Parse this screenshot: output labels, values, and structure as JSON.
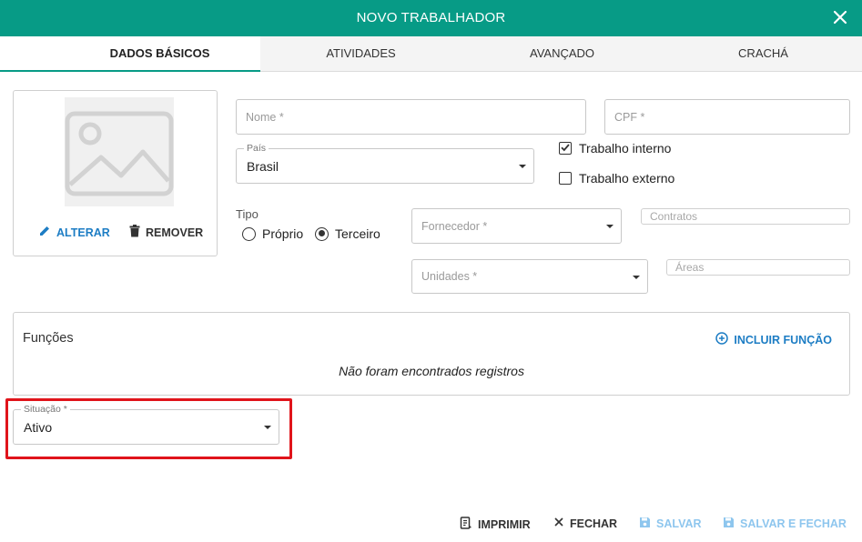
{
  "dialog": {
    "title": "NOVO TRABALHADOR"
  },
  "tabs": [
    {
      "label": "DADOS BÁSICOS",
      "active": true
    },
    {
      "label": "ATIVIDADES",
      "active": false
    },
    {
      "label": "AVANÇADO",
      "active": false
    },
    {
      "label": "CRACHÁ",
      "active": false
    }
  ],
  "photo": {
    "alter_label": "ALTERAR",
    "remove_label": "REMOVER",
    "placeholder_icon": "image-icon"
  },
  "form": {
    "nome_placeholder": "Nome *",
    "cpf_placeholder": "CPF *",
    "pais": {
      "label": "País",
      "value": "Brasil"
    },
    "trabalho_interno": {
      "label": "Trabalho interno",
      "checked": true
    },
    "trabalho_externo": {
      "label": "Trabalho externo",
      "checked": false
    },
    "tipo": {
      "label": "Tipo",
      "options": [
        "Próprio",
        "Terceiro"
      ],
      "selected": "Terceiro"
    },
    "fornecedor_placeholder": "Fornecedor *",
    "contratos_placeholder": "Contratos",
    "unidades_placeholder": "Unidades *",
    "areas_placeholder": "Áreas"
  },
  "funcoes": {
    "title": "Funções",
    "add_label": "INCLUIR FUNÇÃO",
    "empty_text": "Não foram encontrados registros"
  },
  "situacao": {
    "label": "Situação *",
    "value": "Ativo"
  },
  "footer": {
    "print_label": "IMPRIMIR",
    "close_label": "FECHAR",
    "save_label": "SALVAR",
    "save_close_label": "SALVAR E FECHAR"
  },
  "colors": {
    "header": "#079b86",
    "accent_blue": "#1d7dc4",
    "disabled_blue": "#8ec6ee",
    "highlight": "#e0141b"
  }
}
